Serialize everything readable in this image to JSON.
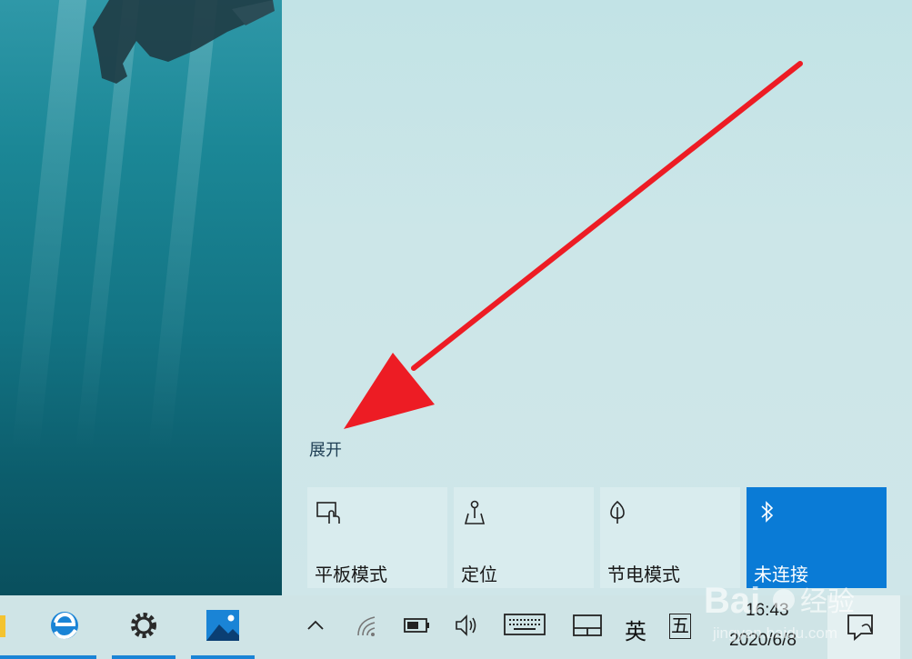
{
  "action_center": {
    "expand_label": "展开",
    "tiles": [
      {
        "label": "平板模式",
        "icon": "tablet-mode-icon",
        "active": false
      },
      {
        "label": "定位",
        "icon": "location-icon",
        "active": false
      },
      {
        "label": "节电模式",
        "icon": "battery-saver-icon",
        "active": false
      },
      {
        "label": "未连接",
        "icon": "bluetooth-icon",
        "active": true
      }
    ]
  },
  "taskbar": {
    "apps": [
      "file-explorer-icon",
      "edge-icon",
      "settings-icon",
      "photos-icon"
    ],
    "tray": {
      "ime_lang": "英",
      "ime_mode": "五",
      "time": "16:43",
      "date": "2020/6/8"
    }
  },
  "watermark": {
    "brand": "Bai",
    "brand_cn": "经验",
    "url": "jingyan.baidu.com"
  },
  "colors": {
    "accent": "#0a7bd6",
    "annotation_arrow": "#ed1c24"
  }
}
